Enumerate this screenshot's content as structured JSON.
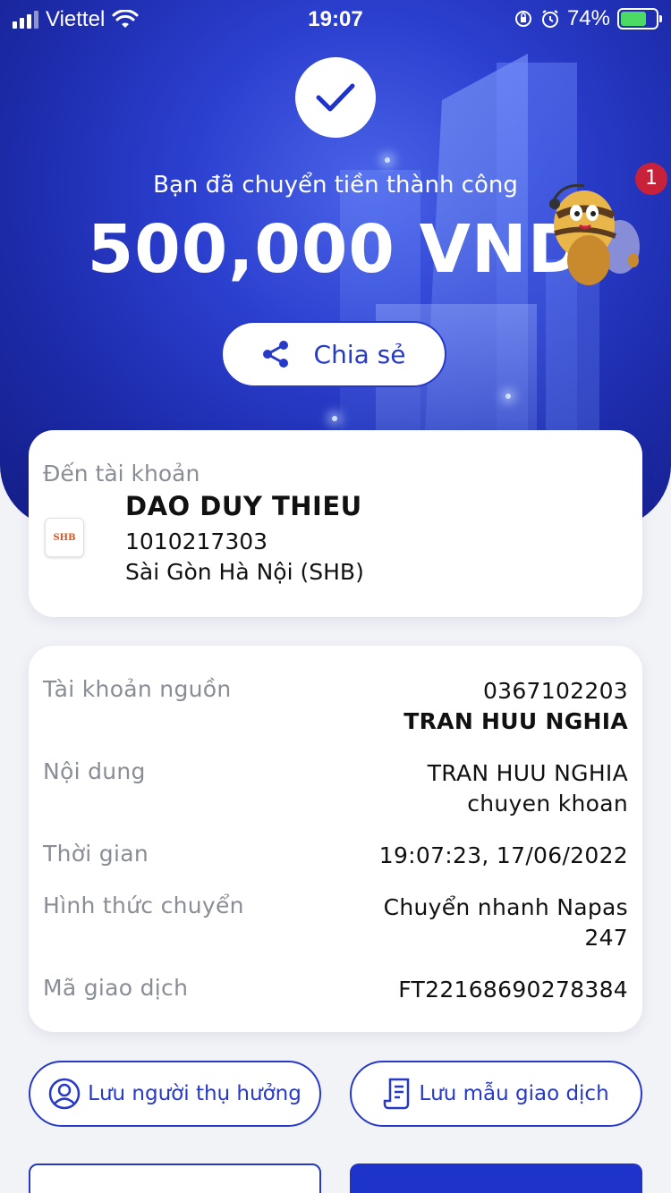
{
  "status_bar": {
    "carrier": "Viettel",
    "time": "19:07",
    "battery_percent": "74%",
    "battery_level": 0.74,
    "icons": [
      "signal-icon",
      "wifi-icon",
      "orientation-lock-icon",
      "alarm-icon",
      "battery-charging-icon"
    ]
  },
  "hero": {
    "success_message": "Bạn đã chuyển tiền thành công",
    "amount": "500,000 VND",
    "notification_count": "1",
    "share_label": "Chia sẻ"
  },
  "destination": {
    "label": "Đến tài khoản",
    "bank_logo_text": "SHB",
    "name": "DAO DUY THIEU",
    "account_number": "1010217303",
    "bank_name": "Sài Gòn Hà Nội (SHB)"
  },
  "details": {
    "source_account": {
      "label": "Tài khoản nguồn",
      "number": "0367102203",
      "name": "TRAN HUU NGHIA"
    },
    "content": {
      "label": "Nội dung",
      "line1": "TRAN HUU NGHIA",
      "line2": "chuyen khoan"
    },
    "time": {
      "label": "Thời gian",
      "value": "19:07:23, 17/06/2022"
    },
    "method": {
      "label": "Hình thức chuyển",
      "line1": "Chuyển nhanh Napas",
      "line2": "247"
    },
    "transaction_id": {
      "label": "Mã giao dịch",
      "value": "FT22168690278384"
    }
  },
  "actions": {
    "save_beneficiary": "Lưu người thụ hưởng",
    "save_template": "Lưu mẫu giao dịch"
  },
  "colors": {
    "brand_blue": "#2639c7",
    "hero_dark": "#1c2aa8",
    "badge_red": "#c8213a"
  }
}
